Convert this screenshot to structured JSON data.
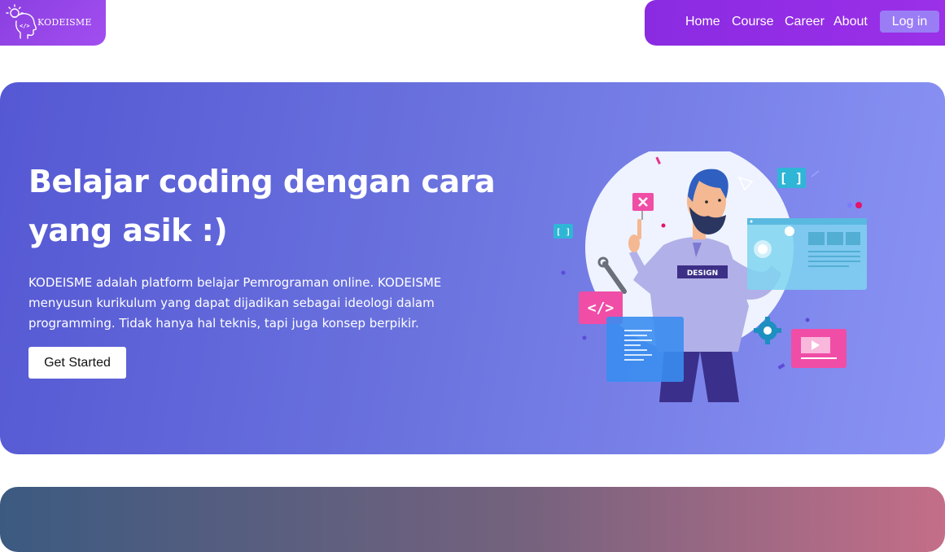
{
  "brand": {
    "name": "KODEISME",
    "logo_icon": "bulb-head-code-icon"
  },
  "nav": {
    "links": [
      "Home",
      "Course",
      "Career",
      "About"
    ],
    "login_label": "Log in"
  },
  "hero": {
    "title_line1": "Belajar coding dengan cara",
    "title_line2": "yang asik :)",
    "description_line1": "KODEISME adalah platform belajar Pemrograman online. KODEISME",
    "description_line2": "menyusun kurikulum yang dapat dijadikan sebagai ideologi dalam",
    "description_line3": "programming. Tidak hanya hal teknis, tapi juga konsep berpikir.",
    "cta_label": "Get Started",
    "illustration": {
      "badge_text": "DESIGN",
      "code_symbol": "</>",
      "bracket_symbol": "[ ]"
    }
  },
  "colors": {
    "nav_purple": "#8a2be2",
    "hero_start": "#5558d3",
    "hero_end": "#8a93f4",
    "login_bg": "#9a7cf5"
  }
}
